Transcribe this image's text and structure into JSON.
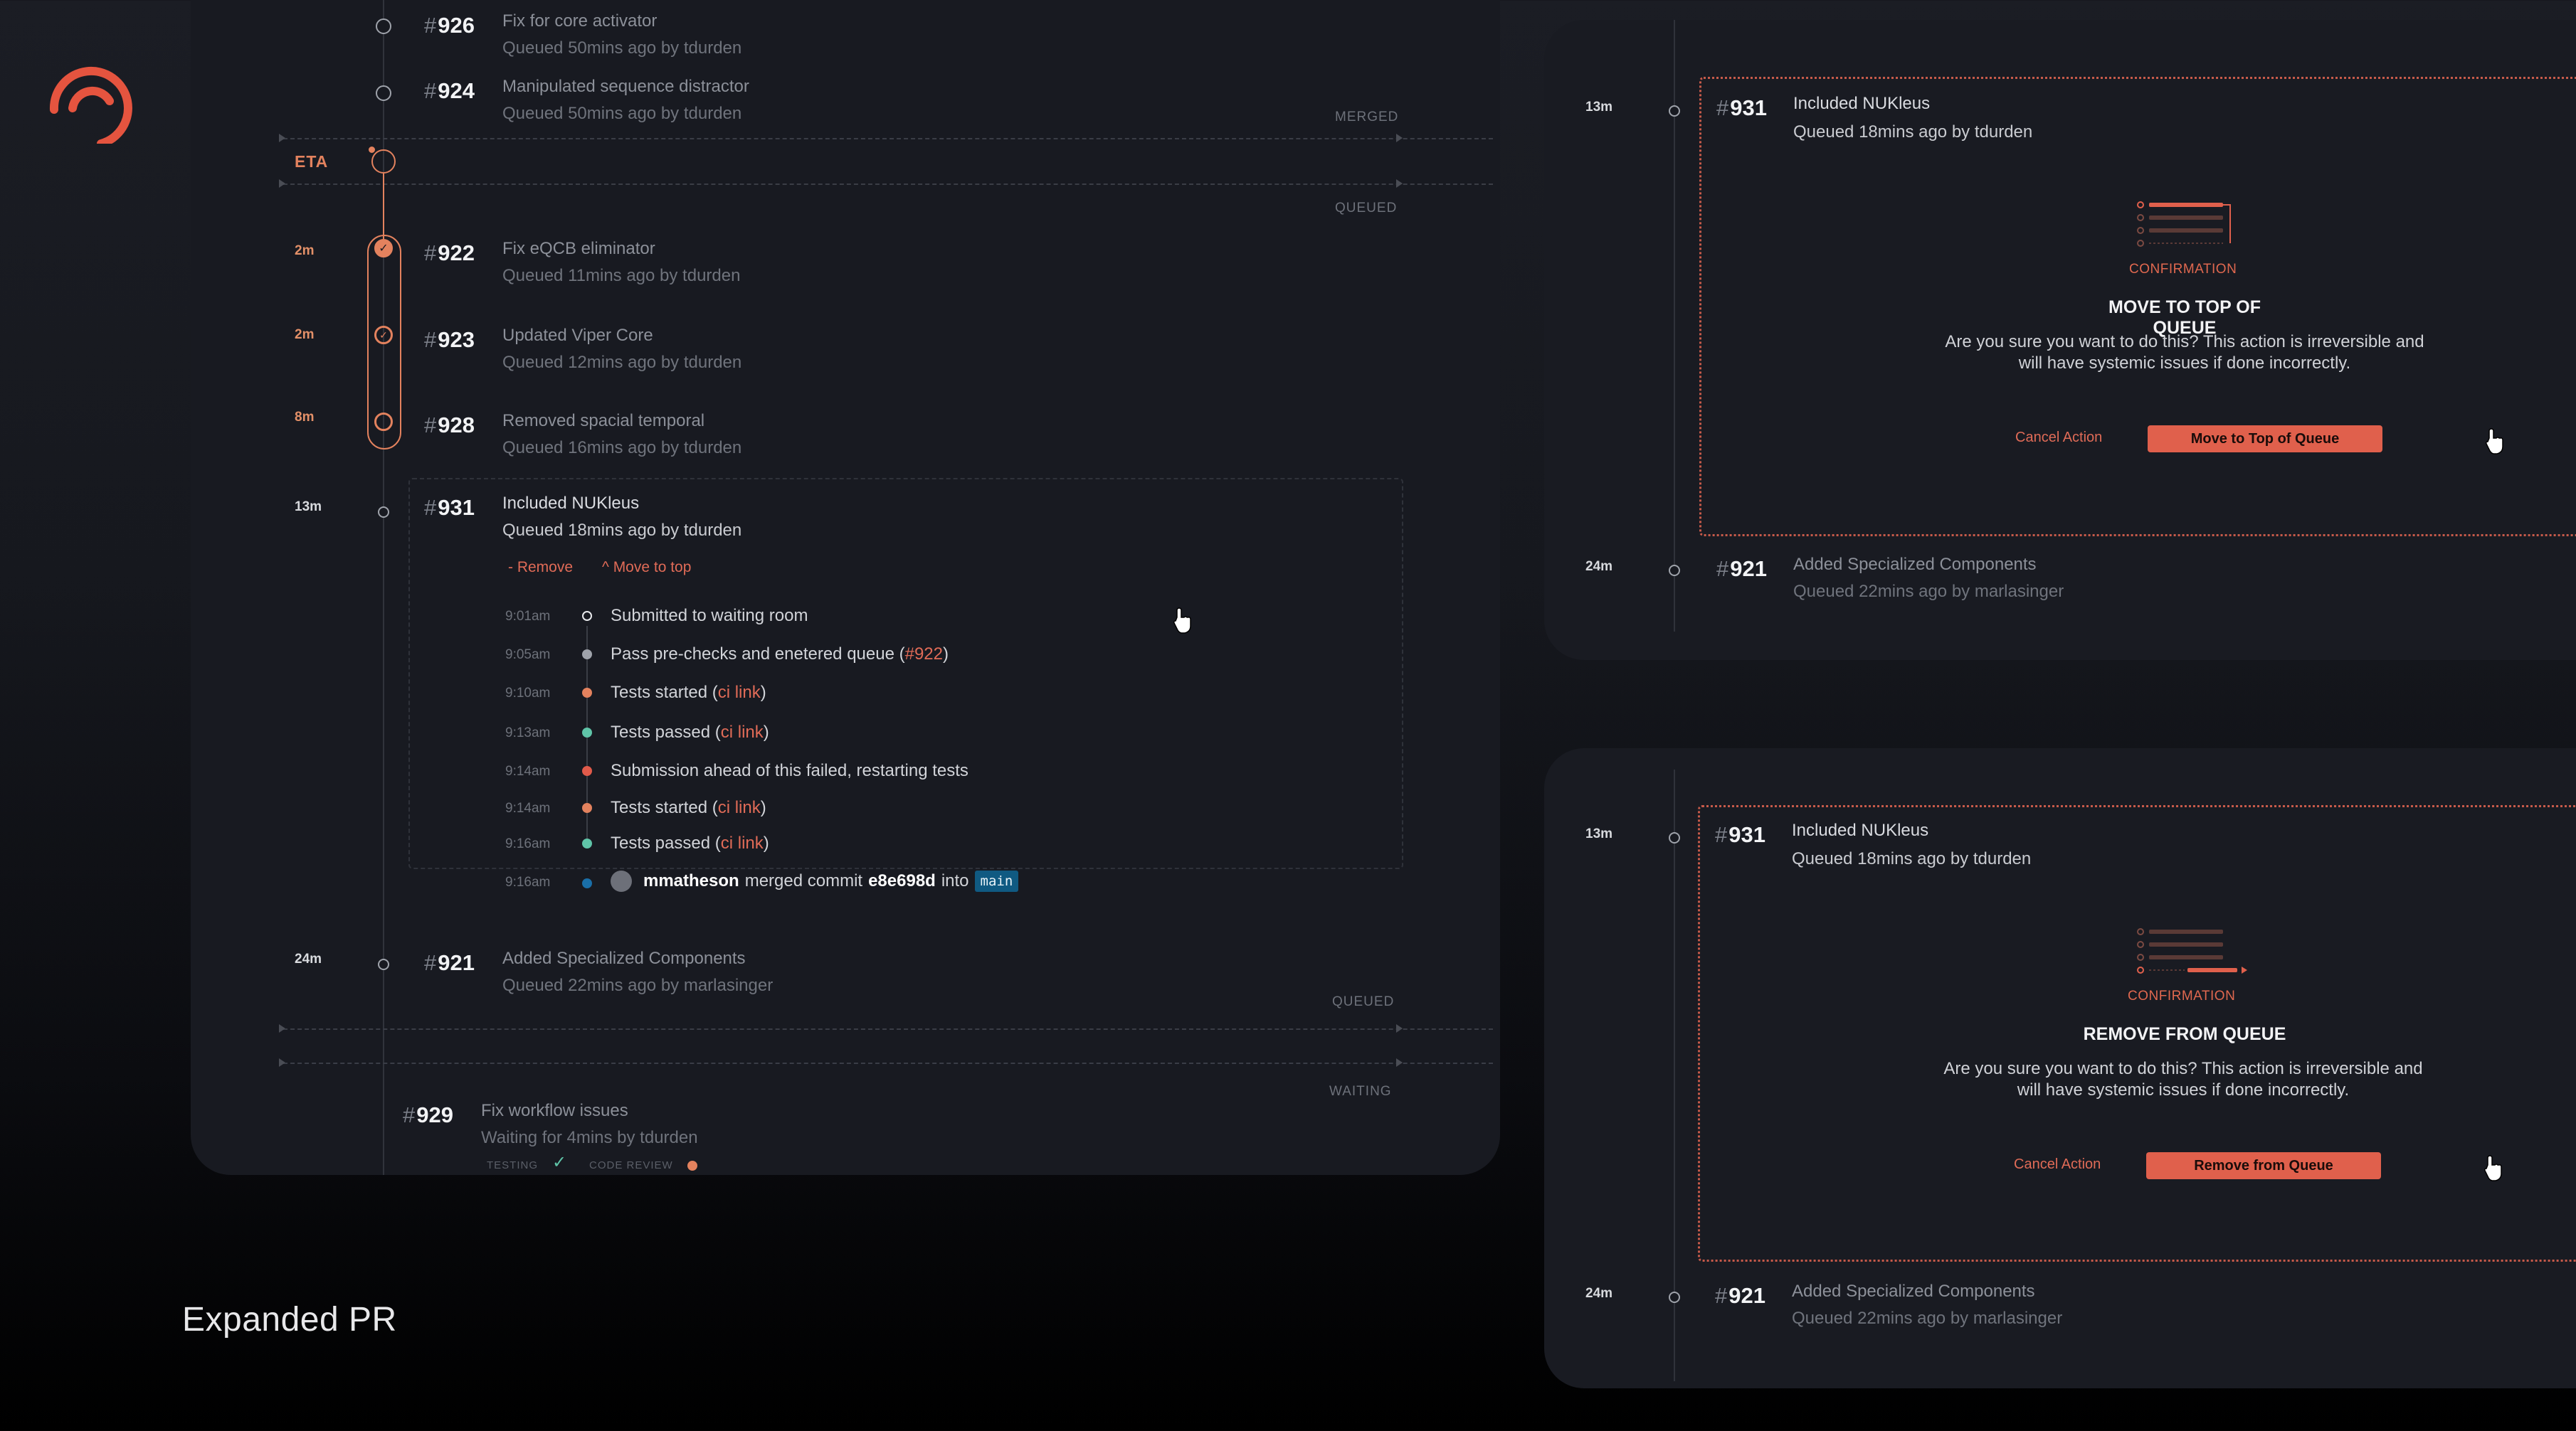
{
  "colors": {
    "accent": "#e0604c",
    "orange": "#e3825e",
    "gray": "#9fa3ab",
    "teal": "#5fc4a8",
    "blue": "#1a6fa8",
    "red": "#e05a4a"
  },
  "caption": "Expanded PR",
  "left": {
    "merged": [
      {
        "num": "926",
        "title": "Fix for core activator",
        "sub": "Queued 50mins ago by tdurden"
      },
      {
        "num": "924",
        "title": "Manipulated sequence distractor",
        "sub": "Queued 50mins ago by tdurden"
      }
    ],
    "merged_label": "MERGED",
    "eta_label": "ETA",
    "queued_label": "QUEUED",
    "batch": [
      {
        "dur": "2m",
        "num": "922",
        "title": "Fix eQCB eliminator",
        "sub": "Queued 11mins ago by tdurden"
      },
      {
        "dur": "2m",
        "num": "923",
        "title": "Updated Viper Core",
        "sub": "Queued 12mins ago by tdurden"
      },
      {
        "dur": "8m",
        "num": "928",
        "title": "Removed spacial temporal",
        "sub": "Queued 16mins ago by tdurden"
      }
    ],
    "expanded": {
      "dur": "13m",
      "num": "931",
      "title": "Included NUKleus",
      "sub": "Queued 18mins ago by tdurden",
      "remove": "- Remove",
      "move": "^ Move to top",
      "timeline": [
        {
          "time": "9:01am",
          "pre": "Submitted to waiting room",
          "link": "",
          "post": ""
        },
        {
          "time": "9:05am",
          "pre": "Pass pre-checks and enetered queue (",
          "link": "#922",
          "post": ")"
        },
        {
          "time": "9:10am",
          "pre": "Tests started (",
          "link": "ci link",
          "post": ")"
        },
        {
          "time": "9:13am",
          "pre": "Tests passed (",
          "link": "ci link",
          "post": ")"
        },
        {
          "time": "9:14am",
          "pre": "Submission ahead of this failed, restarting tests",
          "link": "",
          "post": ""
        },
        {
          "time": "9:14am",
          "pre": "Tests started (",
          "link": "ci link",
          "post": ")"
        },
        {
          "time": "9:16am",
          "pre": "Tests passed (",
          "link": "ci link",
          "post": ")"
        }
      ],
      "merge_row": {
        "time": "9:16am",
        "user": "mmatheson",
        "mid": "merged commit",
        "commit": "e8e698d",
        "into": "into",
        "branch": "main"
      }
    },
    "after": {
      "dur": "24m",
      "num": "921",
      "title": "Added Specialized Components",
      "sub": "Queued 22mins ago by marlasinger"
    },
    "queued_label2": "QUEUED",
    "waiting_label": "WAITING",
    "waiting": {
      "num": "929",
      "title": "Fix workflow issues",
      "sub": "Waiting for 4mins by tdurden",
      "testing": "TESTING",
      "code_review": "CODE REVIEW"
    }
  },
  "dialog_top": {
    "dur": "13m",
    "num": "931",
    "title": "Included NUKleus",
    "sub": "Queued 18mins ago by tdurden",
    "label": "CONFIRMATION",
    "heading": "MOVE TO TOP OF QUEUE",
    "body1": "Are you sure you want to do this? This action is irreversible and",
    "body2": "will have systemic issues if done incorrectly.",
    "cancel": "Cancel Action",
    "confirm": "Move to Top of Queue",
    "after": {
      "dur": "24m",
      "num": "921",
      "title": "Added Specialized Components",
      "sub": "Queued 22mins ago by marlasinger"
    }
  },
  "dialog_bottom": {
    "dur": "13m",
    "num": "931",
    "title": "Included NUKleus",
    "sub": "Queued 18mins ago by tdurden",
    "label": "CONFIRMATION",
    "heading": "REMOVE FROM QUEUE",
    "body1": "Are you sure you want to do this? This action is irreversible and",
    "body2": "will have systemic issues if done incorrectly.",
    "cancel": "Cancel Action",
    "confirm": "Remove from Queue",
    "after": {
      "dur": "24m",
      "num": "921",
      "title": "Added Specialized Components",
      "sub": "Queued 22mins ago by marlasinger"
    }
  }
}
